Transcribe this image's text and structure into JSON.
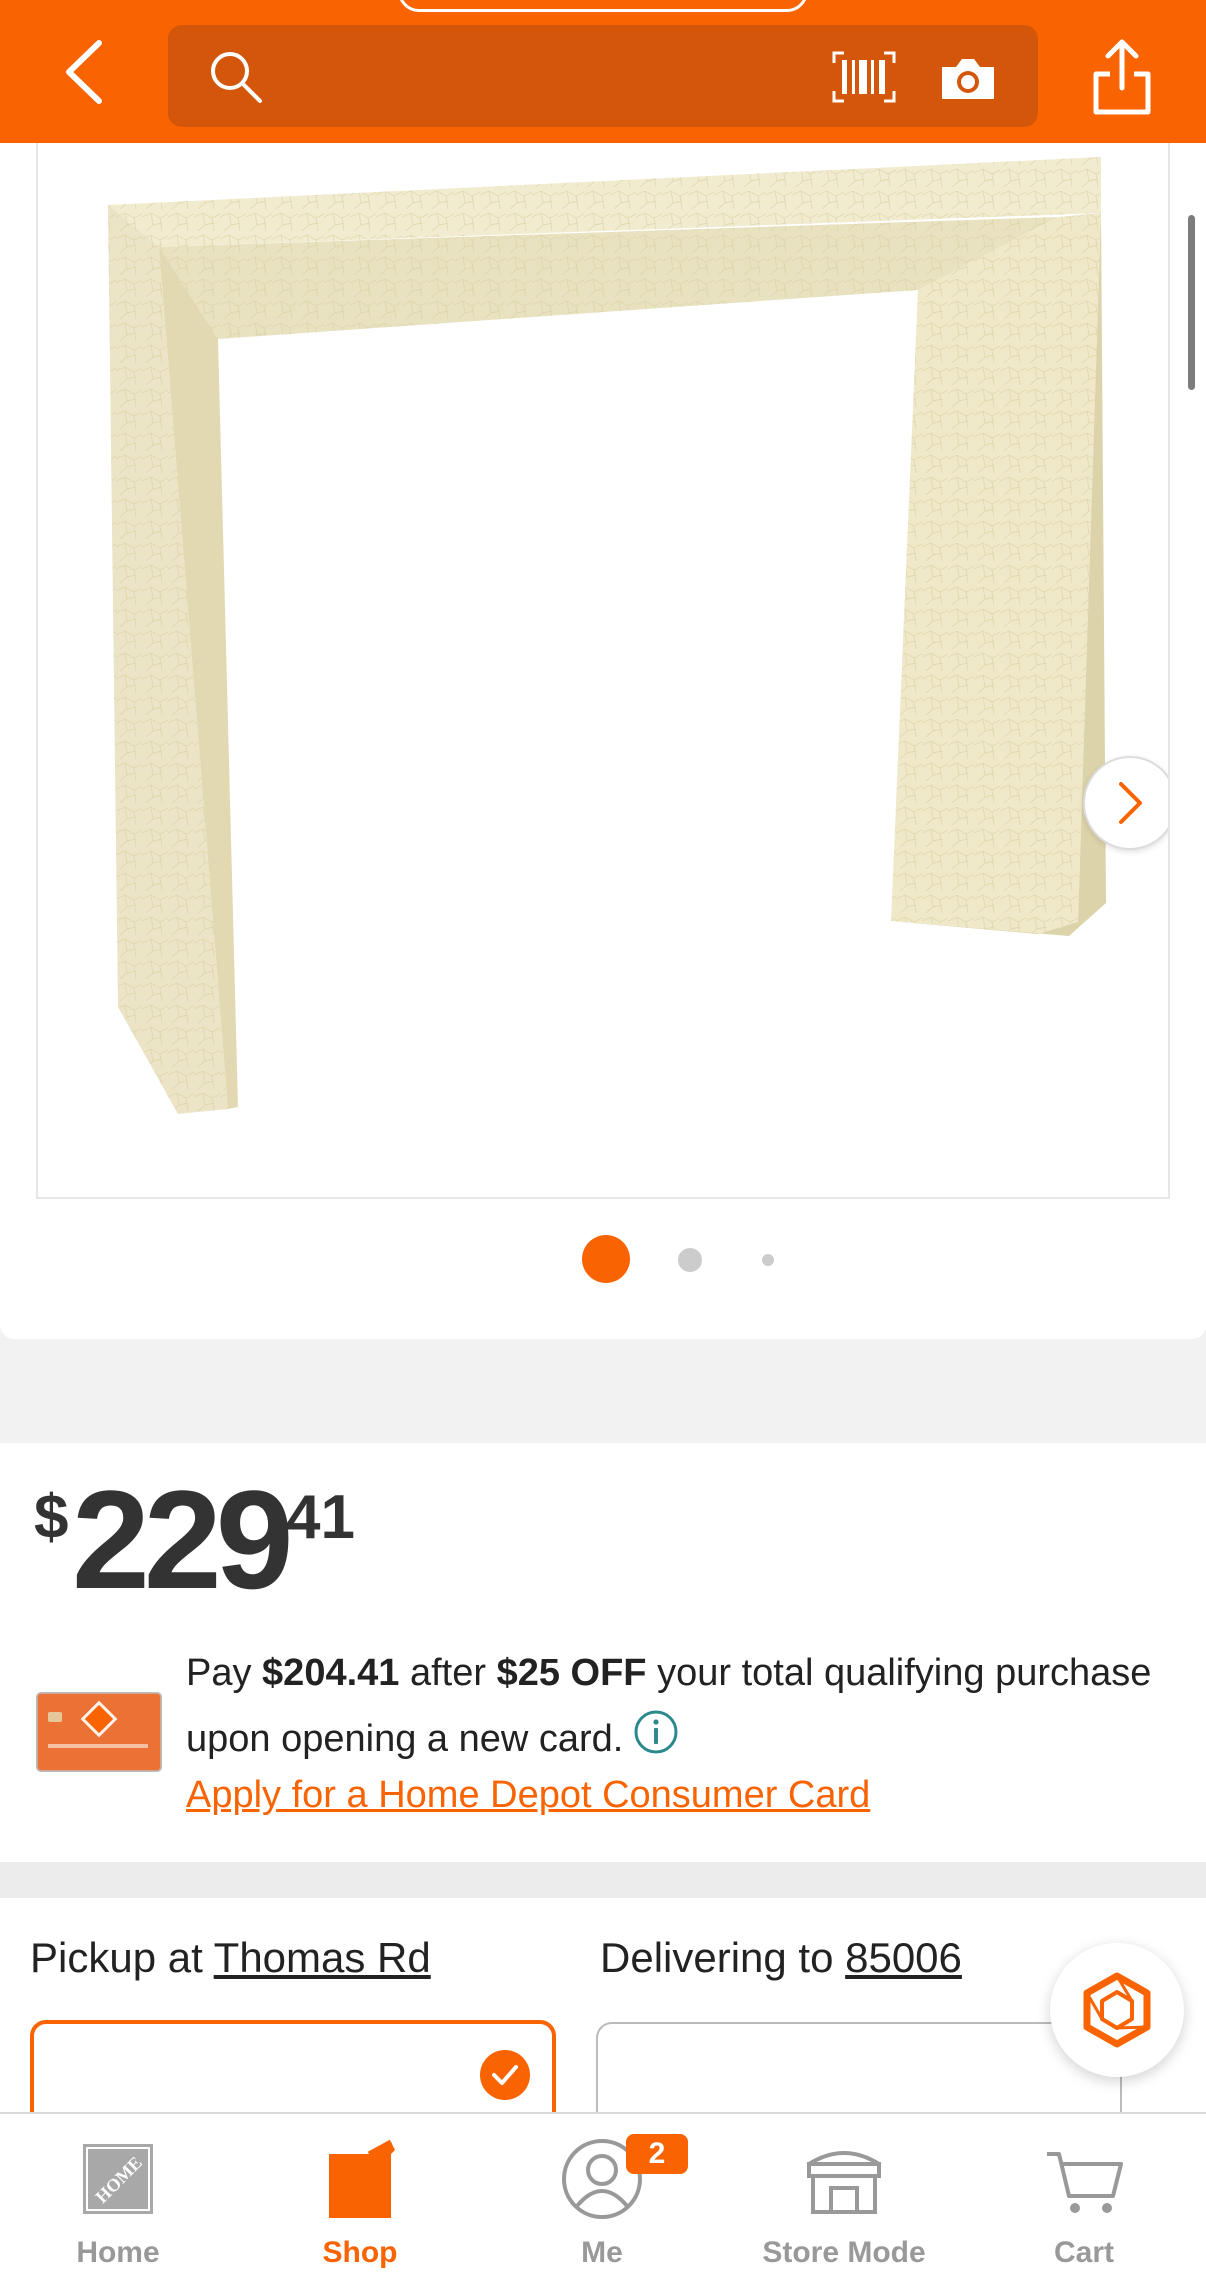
{
  "header": {
    "back_icon": "chevron-left-icon",
    "search_placeholder": "",
    "search_icon": "search-icon",
    "barcode_icon": "barcode-scan-icon",
    "camera_icon": "camera-icon",
    "share_icon": "share-icon"
  },
  "gallery": {
    "image_alt": "Cream crackle-finish console table",
    "next_icon": "chevron-right-icon",
    "total_images": 3,
    "active_index": 0
  },
  "price": {
    "dollar_sign": "$",
    "whole": "229",
    "cents": "41"
  },
  "promo": {
    "pay_prefix": "Pay ",
    "discounted_price": "$204.41",
    "after_text": " after ",
    "discount": "$25 OFF",
    "tail_line1": " your total qualifying purchase upon opening a new card.",
    "info_icon": "info-icon",
    "apply_link": "Apply for a Home Depot Consumer Card",
    "card_icon": "home-depot-credit-card-icon"
  },
  "fulfillment": {
    "pickup_prefix": "Pickup at ",
    "pickup_store": "Thomas Rd",
    "delivery_prefix": "Delivering to ",
    "delivery_zip": "85006",
    "pickup_selected": true
  },
  "chat": {
    "icon": "chat-assistant-icon"
  },
  "bottom_nav": {
    "home": "Home",
    "shop": "Shop",
    "me": "Me",
    "me_badge": "2",
    "store_mode": "Store Mode",
    "cart": "Cart",
    "active": "Shop"
  },
  "colors": {
    "brand_orange": "#f96302",
    "search_bg": "#d4560a",
    "inactive_nav": "#999999"
  }
}
